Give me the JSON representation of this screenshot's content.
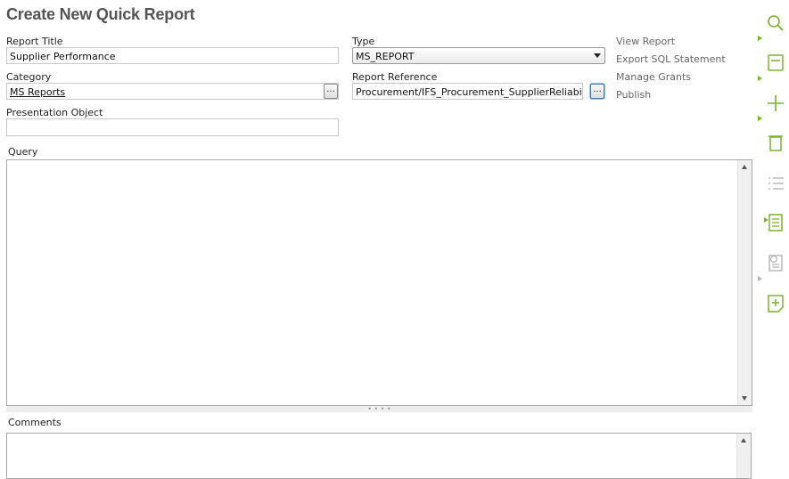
{
  "page": {
    "title": "Create New Quick Report"
  },
  "form": {
    "report_title": {
      "label": "Report Title",
      "value": "Supplier Performance"
    },
    "type": {
      "label": "Type",
      "value": "MS_REPORT"
    },
    "category": {
      "label": "Category",
      "value": "MS Reports",
      "browse": "..."
    },
    "report_reference": {
      "label": "Report Reference",
      "value": "Procurement/IFS_Procurement_SupplierReliability",
      "browse": "..."
    },
    "presentation_object": {
      "label": "Presentation Object",
      "value": ""
    },
    "query": {
      "label": "Query",
      "value": ""
    },
    "comments": {
      "label": "Comments",
      "value": ""
    }
  },
  "actions": [
    "View Report",
    "Export SQL Statement",
    "Manage Grants",
    "Publish"
  ],
  "splitter_grip": "• • • •",
  "toolbar": {
    "icons": [
      "search-icon",
      "save-icon",
      "add-icon",
      "delete-icon",
      "list-icon",
      "details-icon",
      "info-icon",
      "new-note-icon"
    ],
    "accent_color": "#7bb32e",
    "disabled_color": "#b5b5b5"
  }
}
